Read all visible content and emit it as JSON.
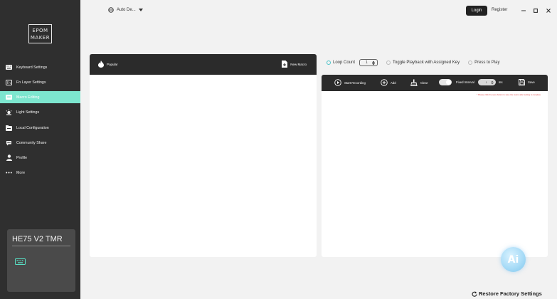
{
  "sidebar": {
    "logo_lines": [
      "EPOM",
      "MAKER"
    ],
    "items": [
      {
        "label": "Keyboard Settings",
        "icon": "keyboard-icon"
      },
      {
        "label": "Fn Layer Settings",
        "icon": "fn-layer-icon"
      },
      {
        "label": "Macro Editing",
        "icon": "macro-icon",
        "active": true
      },
      {
        "label": "Light Settings",
        "icon": "light-icon"
      },
      {
        "label": "Local Configuration",
        "icon": "folder-icon"
      },
      {
        "label": "Community Share",
        "icon": "community-icon"
      },
      {
        "label": "Profile",
        "icon": "user-icon"
      },
      {
        "label": "More",
        "icon": "more-icon"
      }
    ],
    "device_name": "HE75 V2 TMR"
  },
  "topbar": {
    "device_select": "Auto De...",
    "login": "Login",
    "register": "Register"
  },
  "left_panel": {
    "popular": "Popular",
    "new_macro": "New Macro"
  },
  "options": {
    "loop_count_label": "Loop Count",
    "loop_count_value": "1",
    "toggle_playback": "Toggle Playback with Assigned Key",
    "press_to_play": "Press to Play"
  },
  "toolbar": {
    "start_recording": "Start Recording",
    "add": "Add",
    "clear": "Clear",
    "fixed_interval": "Fixed Interval",
    "interval_value": "1",
    "interval_unit": "ms",
    "save": "Save",
    "hint": "* Please click the save button to save the macro after setting is complete"
  },
  "ai_label": "Ai",
  "restore": "Restore Factory Settings",
  "colors": {
    "accent": "#7de6cf",
    "sidebar_bg": "#2f2f2f",
    "hint_red": "#e04a4a"
  }
}
